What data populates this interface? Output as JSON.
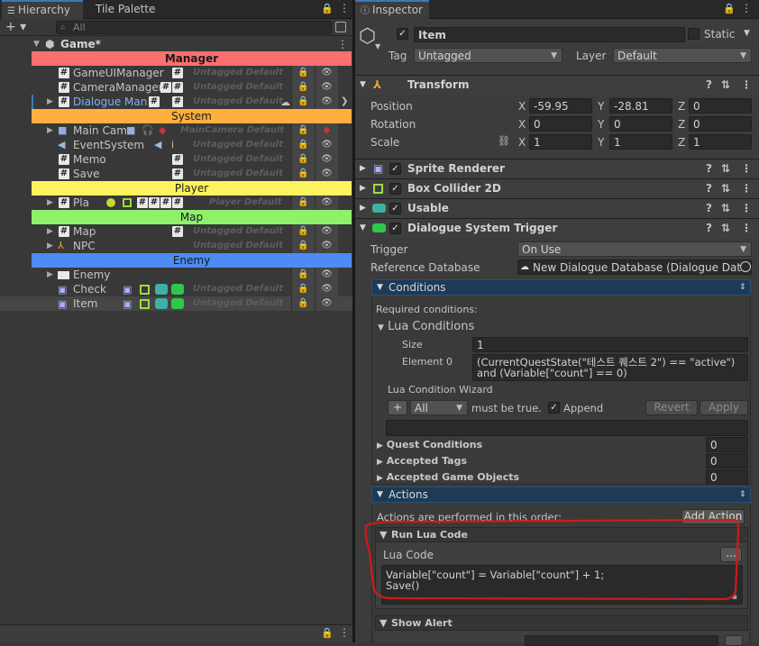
{
  "hierarchy": {
    "tabs": {
      "hierarchy": "Hierarchy",
      "tile_palette": "Tile Palette"
    },
    "add_label": "+ ▾",
    "search_placeholder": "All",
    "scene_name": "Game*",
    "rows": [
      {
        "kind": "header",
        "label": "Manager",
        "color": "#fd6f6f"
      },
      {
        "kind": "obj",
        "name": "GameUIManager",
        "tag": "Untagged Default"
      },
      {
        "kind": "obj",
        "name": "CameraManager",
        "tag": "Untagged Default"
      },
      {
        "kind": "obj",
        "name": "Dialogue Man",
        "tag": "Untagged Default"
      },
      {
        "kind": "header",
        "label": "System",
        "color": "#feaf3f"
      },
      {
        "kind": "obj",
        "name": "Main Came",
        "tag": "MainCamera Default"
      },
      {
        "kind": "obj",
        "name": "EventSystem",
        "tag": "Untagged Default"
      },
      {
        "kind": "obj",
        "name": "Memo",
        "tag": "Untagged Default"
      },
      {
        "kind": "obj",
        "name": "Save",
        "tag": "Untagged Default"
      },
      {
        "kind": "header",
        "label": "Player",
        "color": "#fcf35e"
      },
      {
        "kind": "obj",
        "name": "Pla",
        "tag": "Player Default"
      },
      {
        "kind": "header",
        "label": "Map",
        "color": "#8ff06a"
      },
      {
        "kind": "obj",
        "name": "Map",
        "tag": "Untagged Default"
      },
      {
        "kind": "obj",
        "name": "NPC",
        "tag": "Untagged Default"
      },
      {
        "kind": "header",
        "label": "Enemy",
        "color": "#4c8cf4"
      },
      {
        "kind": "obj",
        "name": "Enemy",
        "tag": ""
      },
      {
        "kind": "obj",
        "name": "Check",
        "tag": "Untagged Default"
      },
      {
        "kind": "obj",
        "name": "Item",
        "tag": "Untagged Default"
      }
    ]
  },
  "inspector": {
    "tab": "Inspector",
    "object_name": "Item",
    "static_label": "Static",
    "tag_label": "Tag",
    "tag_value": "Untagged",
    "layer_label": "Layer",
    "layer_value": "Default",
    "transform": {
      "title": "Transform",
      "position_label": "Position",
      "rotation_label": "Rotation",
      "scale_label": "Scale",
      "axis_x": "X",
      "axis_y": "Y",
      "axis_z": "Z",
      "position": [
        "-59.95",
        "-28.81",
        "0"
      ],
      "rotation": [
        "0",
        "0",
        "0"
      ],
      "scale": [
        "1",
        "1",
        "1"
      ]
    },
    "components": {
      "sprite_renderer": "Sprite Renderer",
      "box_collider": "Box Collider 2D",
      "usable": "Usable",
      "trigger": "Dialogue System Trigger"
    },
    "trigger_label": "Trigger",
    "trigger_value": "On Use",
    "ref_db_label": "Reference Database",
    "ref_db_value": "New Dialogue Database (Dialogue Data",
    "conditions_bar": "Conditions",
    "required_conditions": "Required conditions:",
    "lua_conditions": "Lua Conditions",
    "size_label": "Size",
    "size_value": "1",
    "element0_label": "Element 0",
    "element0_line1": "(CurrentQuestState(\"테스트 퀘스트 2\") == \"active\")",
    "element0_line2": "and (Variable[\"count\"] == 0)",
    "wizard_label": "Lua Condition Wizard",
    "wizard_add": "+",
    "wizard_all": "All",
    "must_be_true": "must be true.",
    "append_label": "Append",
    "revert_label": "Revert",
    "apply_label": "Apply",
    "quest_conditions": "Quest Conditions",
    "quest_conditions_value": "0",
    "accepted_tags": "Accepted Tags",
    "accepted_tags_value": "0",
    "accepted_game_objects": "Accepted Game Objects",
    "accepted_game_objects_value": "0",
    "actions_bar": "Actions",
    "actions_order": "Actions are performed in this order:",
    "add_action": "Add Action",
    "run_lua_code": "Run Lua Code",
    "lua_code_label": "Lua Code",
    "lua_code_more": "...",
    "lua_line1": "Variable[\"count\"] = Variable[\"count\"] + 1;",
    "lua_line2": "Save()",
    "show_alert": "Show Alert"
  },
  "colors": {
    "highlight": "#d11a1a",
    "selection_blue": "#3a79bb"
  }
}
